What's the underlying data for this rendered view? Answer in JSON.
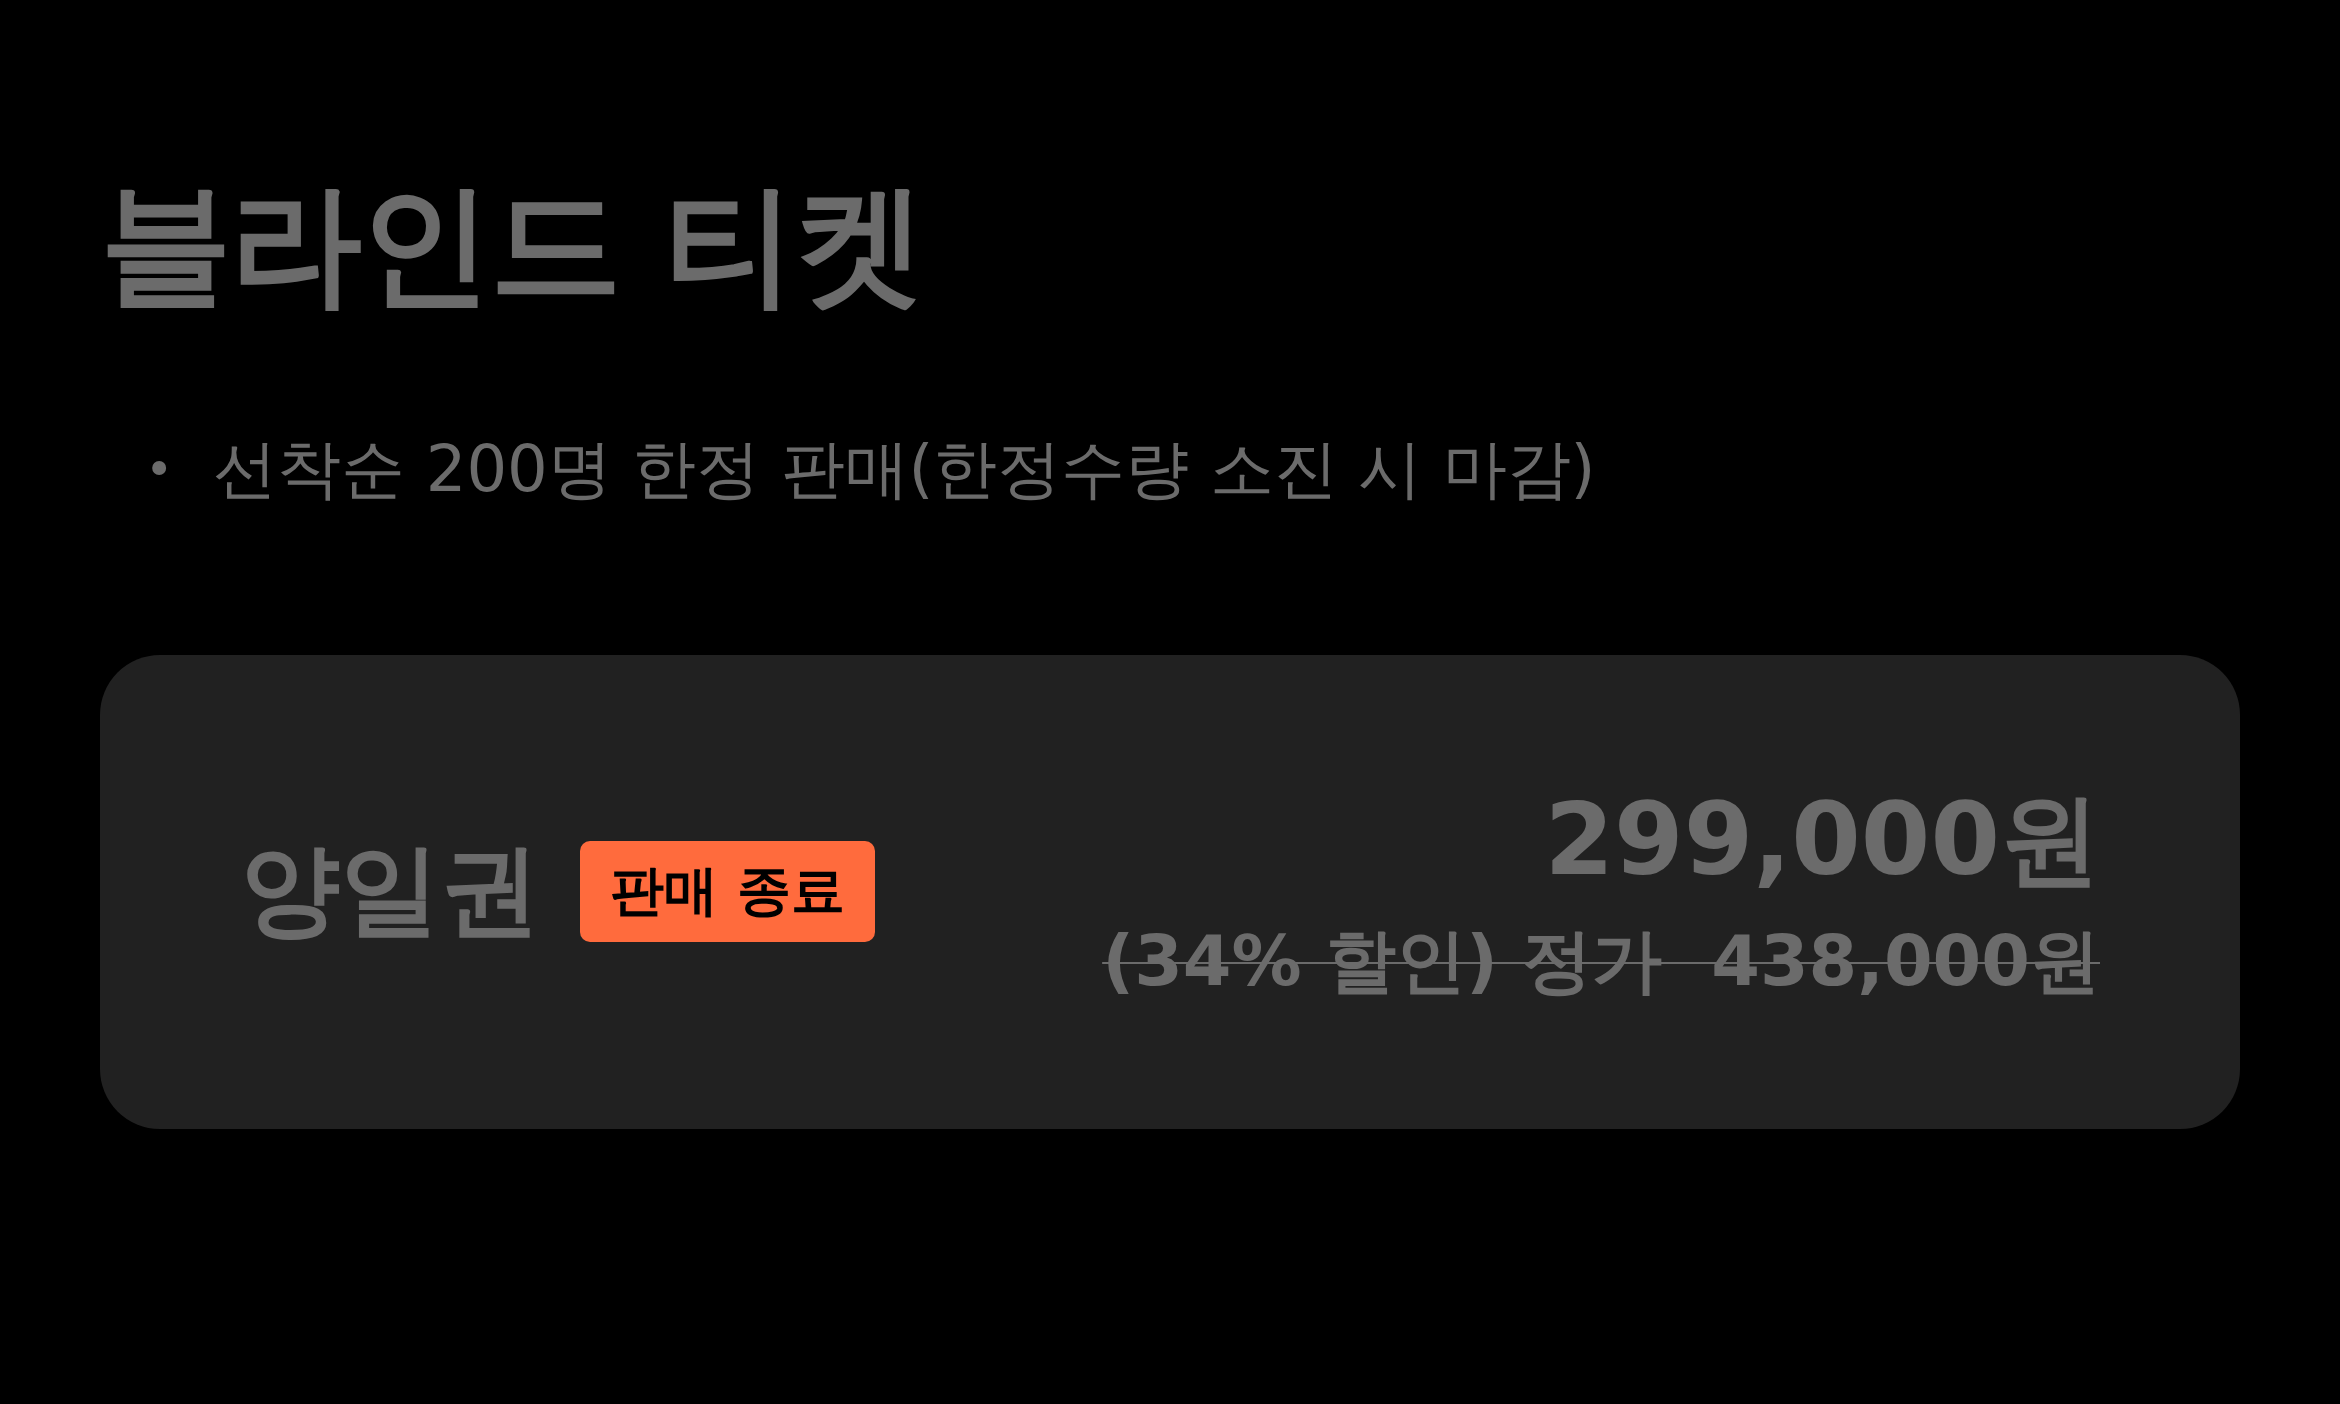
{
  "title": "블라인드 티켓",
  "notes": [
    {
      "bullet": "•",
      "text": "선착순 200명 한정 판매(한정수량 소진 시 마감)"
    }
  ],
  "tickets": [
    {
      "name": "양일권",
      "badge": "판매 종료",
      "price": "299,000원",
      "original_price": "(34% 할인) 정가  438,000원",
      "struck": true
    }
  ]
}
